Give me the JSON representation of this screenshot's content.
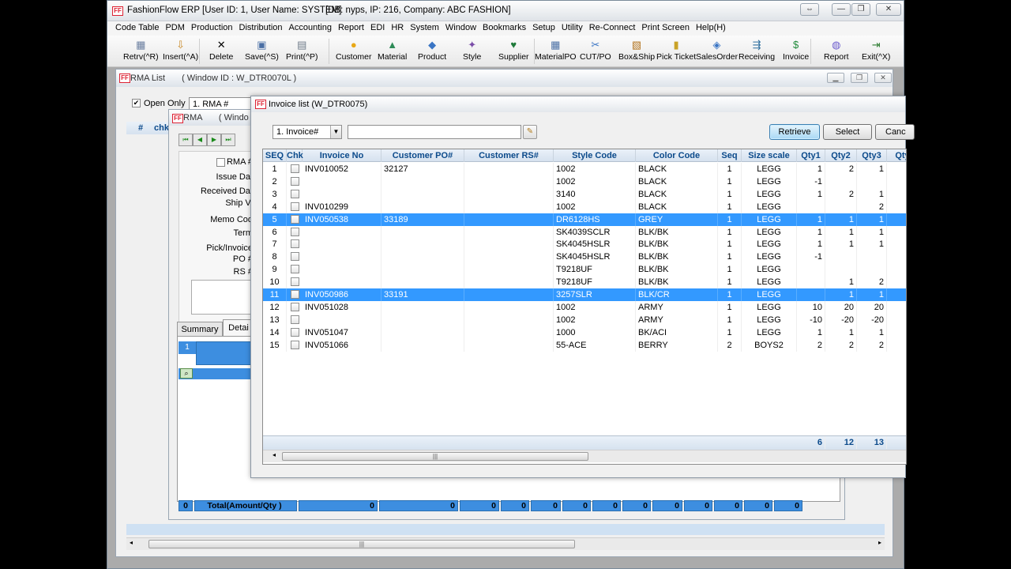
{
  "app": {
    "title": "FashionFlow ERP [User ID: 1, User Name: SYSTEM]",
    "db_info": "[DB: nyps, IP: 216, Company: ABC FASHION]",
    "logo": "FF"
  },
  "menu": [
    "Code Table",
    "PDM",
    "Production",
    "Distribution",
    "Accounting",
    "Report",
    "EDI",
    "HR",
    "System",
    "Window",
    "Bookmarks",
    "Setup",
    "Utility",
    "Re-Connect",
    "Print Screen",
    "Help(H)"
  ],
  "toolbar": [
    {
      "label": "Retrv(^R)",
      "icon": "retrieve-icon",
      "glyph": "▦",
      "color": "#6b7fa0"
    },
    {
      "label": "Insert(^A)",
      "icon": "insert-icon",
      "glyph": "⇩",
      "color": "#c98b2b"
    },
    {
      "label": "Delete",
      "icon": "delete-icon",
      "glyph": "✕",
      "color": "#000000"
    },
    {
      "label": "Save(^S)",
      "icon": "save-icon",
      "glyph": "▣",
      "color": "#4a6fa5"
    },
    {
      "label": "Print(^P)",
      "icon": "print-icon",
      "glyph": "▤",
      "color": "#6d7a88"
    },
    {
      "label": "Customer",
      "icon": "customer-icon",
      "glyph": "●",
      "color": "#e8a817"
    },
    {
      "label": "Material",
      "icon": "material-icon",
      "glyph": "▲",
      "color": "#2e8b57"
    },
    {
      "label": "Product",
      "icon": "product-icon",
      "glyph": "◆",
      "color": "#3a75c4"
    },
    {
      "label": "Style",
      "icon": "style-icon",
      "glyph": "✦",
      "color": "#7a4da8"
    },
    {
      "label": "Supplier",
      "icon": "supplier-icon",
      "glyph": "♥",
      "color": "#1f7a3a"
    },
    {
      "label": "MaterialPO",
      "icon": "materialpo-icon",
      "glyph": "▦",
      "color": "#4a6fa5"
    },
    {
      "label": "CUT/PO",
      "icon": "cutpo-icon",
      "glyph": "✂",
      "color": "#3a75c4"
    },
    {
      "label": "Box&Ship",
      "icon": "boxship-icon",
      "glyph": "▧",
      "color": "#b3741f"
    },
    {
      "label": "Pick Ticket",
      "icon": "pickticket-icon",
      "glyph": "▮",
      "color": "#c9a227"
    },
    {
      "label": "SalesOrder",
      "icon": "salesorder-icon",
      "glyph": "◈",
      "color": "#3a75c4"
    },
    {
      "label": "Receiving",
      "icon": "receiving-icon",
      "glyph": "⇶",
      "color": "#2f6f9f"
    },
    {
      "label": "Invoice",
      "icon": "invoice-icon",
      "glyph": "$",
      "color": "#1f8a3a"
    },
    {
      "label": "Report",
      "icon": "report-icon",
      "glyph": "◍",
      "color": "#6a5acd"
    },
    {
      "label": "Exit(^X)",
      "icon": "exit-icon",
      "glyph": "⇥",
      "color": "#2e7d32"
    }
  ],
  "rma_list": {
    "title": "RMA List",
    "window_id": "( Window ID : W_DTR0070L )",
    "open_only_label": "Open Only",
    "search_combo": "1. RMA #",
    "grid_header_hash": "#",
    "grid_header_chk": "chk"
  },
  "rma": {
    "title": "RMA",
    "window_id": "( Windo",
    "fields": [
      "RMA #",
      "Issue Dat",
      "Received Dat",
      "Ship Vi",
      "Memo Cod",
      "Term",
      "Pick/Invoice",
      "PO #",
      "RS #"
    ],
    "tabs": [
      "Summary",
      "Detai"
    ],
    "total_count": "0",
    "total_label": "Total(Amount/Qty )",
    "total_values": [
      "0",
      "0",
      "0",
      "0",
      "0",
      "0",
      "0",
      "0",
      "0",
      "0",
      "0",
      "0",
      "0"
    ],
    "row_no": "1"
  },
  "invoice_list": {
    "title": "Invoice list (W_DTR0075)",
    "search_combo": "1. Invoice#",
    "search_value": "",
    "buttons": {
      "retrieve": "Retrieve",
      "select": "Select",
      "cancel": "Canc"
    },
    "columns": [
      "SEQ",
      "Chk",
      "Invoice No",
      "Customer PO#",
      "Customer RS#",
      "Style Code",
      "Color Code",
      "Seq",
      "Size scale",
      "Qty1",
      "Qty2",
      "Qty3",
      "Qty"
    ],
    "rows": [
      {
        "seq": "1",
        "inv": "INV010052",
        "po": "32127",
        "rs": "",
        "style": "1002",
        "color": "BLACK",
        "s": "1",
        "scale": "LEGG",
        "q1": "1",
        "q2": "2",
        "q3": "1",
        "sel": false
      },
      {
        "seq": "2",
        "inv": "",
        "po": "",
        "rs": "",
        "style": "1002",
        "color": "BLACK",
        "s": "1",
        "scale": "LEGG",
        "q1": "-1",
        "q2": "",
        "q3": "",
        "sel": false
      },
      {
        "seq": "3",
        "inv": "",
        "po": "",
        "rs": "",
        "style": "3140",
        "color": "BLACK",
        "s": "1",
        "scale": "LEGG",
        "q1": "1",
        "q2": "2",
        "q3": "1",
        "sel": false
      },
      {
        "seq": "4",
        "inv": "INV010299",
        "po": "",
        "rs": "",
        "style": "1002",
        "color": "BLACK",
        "s": "1",
        "scale": "LEGG",
        "q1": "",
        "q2": "",
        "q3": "2",
        "sel": false
      },
      {
        "seq": "5",
        "inv": "INV050538",
        "po": "33189",
        "rs": "",
        "style": "DR6128HS",
        "color": "GREY",
        "s": "1",
        "scale": "LEGG",
        "q1": "1",
        "q2": "1",
        "q3": "1",
        "sel": true
      },
      {
        "seq": "6",
        "inv": "",
        "po": "",
        "rs": "",
        "style": "SK4039SCLR",
        "color": "BLK/BK",
        "s": "1",
        "scale": "LEGG",
        "q1": "1",
        "q2": "1",
        "q3": "1",
        "sel": false
      },
      {
        "seq": "7",
        "inv": "",
        "po": "",
        "rs": "",
        "style": "SK4045HSLR",
        "color": "BLK/BK",
        "s": "1",
        "scale": "LEGG",
        "q1": "1",
        "q2": "1",
        "q3": "1",
        "sel": false
      },
      {
        "seq": "8",
        "inv": "",
        "po": "",
        "rs": "",
        "style": "SK4045HSLR",
        "color": "BLK/BK",
        "s": "1",
        "scale": "LEGG",
        "q1": "-1",
        "q2": "",
        "q3": "",
        "sel": false
      },
      {
        "seq": "9",
        "inv": "",
        "po": "",
        "rs": "",
        "style": "T9218UF",
        "color": "BLK/BK",
        "s": "1",
        "scale": "LEGG",
        "q1": "",
        "q2": "",
        "q3": "",
        "sel": false
      },
      {
        "seq": "10",
        "inv": "",
        "po": "",
        "rs": "",
        "style": "T9218UF",
        "color": "BLK/BK",
        "s": "1",
        "scale": "LEGG",
        "q1": "",
        "q2": "1",
        "q3": "2",
        "sel": false
      },
      {
        "seq": "11",
        "inv": "INV050986",
        "po": "33191",
        "rs": "",
        "style": "3257SLR",
        "color": "BLK/CR",
        "s": "1",
        "scale": "LEGG",
        "q1": "",
        "q2": "1",
        "q3": "1",
        "sel": true
      },
      {
        "seq": "12",
        "inv": "INV051028",
        "po": "",
        "rs": "",
        "style": "1002",
        "color": "ARMY",
        "s": "1",
        "scale": "LEGG",
        "q1": "10",
        "q2": "20",
        "q3": "20",
        "sel": false
      },
      {
        "seq": "13",
        "inv": "",
        "po": "",
        "rs": "",
        "style": "1002",
        "color": "ARMY",
        "s": "1",
        "scale": "LEGG",
        "q1": "-10",
        "q2": "-20",
        "q3": "-20",
        "sel": false
      },
      {
        "seq": "14",
        "inv": "INV051047",
        "po": "",
        "rs": "",
        "style": "1000",
        "color": "BK/ACI",
        "s": "1",
        "scale": "LEGG",
        "q1": "1",
        "q2": "1",
        "q3": "1",
        "sel": false
      },
      {
        "seq": "15",
        "inv": "INV051066",
        "po": "",
        "rs": "",
        "style": "55-ACE",
        "color": "BERRY",
        "s": "2",
        "scale": "BOYS2",
        "q1": "2",
        "q2": "2",
        "q3": "2",
        "sel": false
      }
    ],
    "totals": {
      "q1": "6",
      "q2": "12",
      "q3": "13"
    }
  },
  "colors": {
    "selection": "#3399ff",
    "header_text": "#0b4a8b",
    "accent_button": "#a9d9f5"
  }
}
